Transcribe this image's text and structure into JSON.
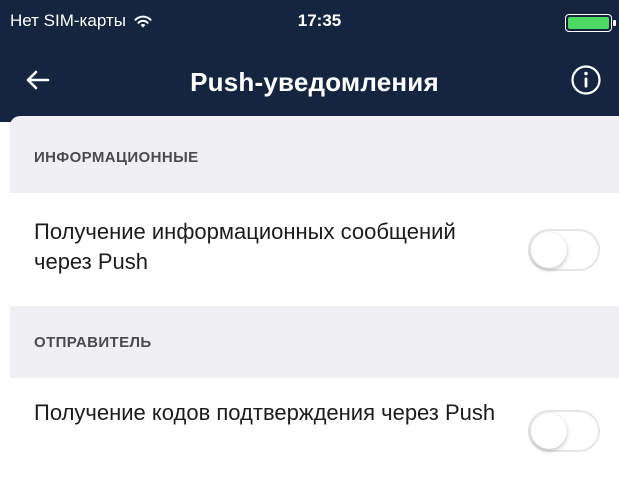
{
  "status_bar": {
    "carrier": "Нет SIM-карты",
    "time": "17:35",
    "wifi_icon": "wifi-icon",
    "battery_icon": "battery-icon",
    "battery_color": "#4cd964"
  },
  "nav": {
    "title": "Push-уведомления",
    "back_icon": "back-arrow-icon",
    "info_icon": "info-icon",
    "background": "#152540"
  },
  "sections": [
    {
      "header": "ИНФОРМАЦИОННЫЕ",
      "rows": [
        {
          "label": "Получение информационных сообщений через Push",
          "toggle_on": false
        }
      ]
    },
    {
      "header": "ОТПРАВИТЕЛЬ",
      "rows": [
        {
          "label": "Получение кодов подтверждения через Push",
          "toggle_on": false
        }
      ]
    }
  ]
}
